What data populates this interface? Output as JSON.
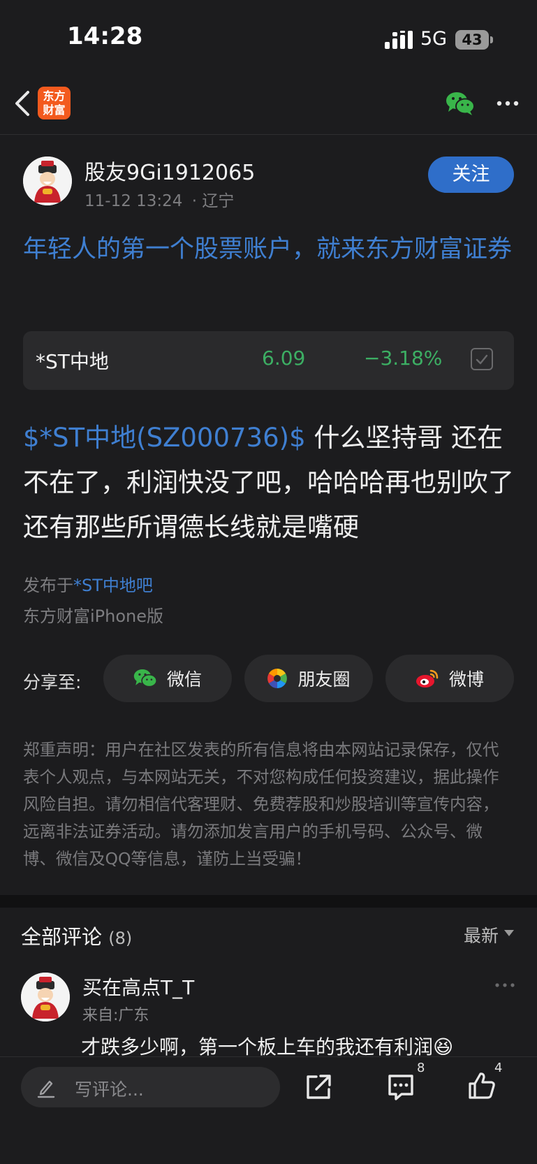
{
  "status_bar": {
    "time": "14:28",
    "network": "5G",
    "battery": "43"
  },
  "nav": {
    "logo_line1": "东方",
    "logo_line2": "财富"
  },
  "post": {
    "username": "股友9Gi1912065",
    "timestamp": "11-12 13:24",
    "location": "· 辽宁",
    "follow_label": "关注",
    "headline": "年轻人的第一个股票账户，就来东方财富证券",
    "stock": {
      "name": "*ST中地",
      "price": "6.09",
      "change": "−3.18%"
    },
    "body_tag": "$*ST中地(SZ000736)$",
    "body_text": " 什么坚持哥 还在不在了，利润快没了吧，哈哈哈再也别吹了 还有那些所谓德长线就是嘴硬",
    "posted_prefix": "发布于",
    "posted_bar": "*ST中地吧",
    "client": "东方财富iPhone版"
  },
  "share": {
    "label": "分享至:",
    "options": [
      {
        "label": "微信",
        "icon": "wechat-icon"
      },
      {
        "label": "朋友圈",
        "icon": "moments-icon"
      },
      {
        "label": "微博",
        "icon": "weibo-icon"
      }
    ]
  },
  "disclaimer": "郑重声明：用户在社区发表的所有信息将由本网站记录保存，仅代表个人观点，与本网站无关，不对您构成任何投资建议，据此操作风险自担。请勿相信代客理财、免费荐股和炒股培训等宣传内容，远离非法证券活动。请勿添加发言用户的手机号码、公众号、微博、微信及QQ等信息，谨防上当受骗！",
  "comments": {
    "title": "全部评论",
    "count": "(8)",
    "sort": "最新",
    "items": [
      {
        "username": "买在高点T_T",
        "from": "来自:广东",
        "text": "才跌多少啊，第一个板上车的我还有利润😆"
      }
    ]
  },
  "bottom_bar": {
    "placeholder": "写评论...",
    "comment_count": "8",
    "like_count": "4"
  },
  "colors": {
    "link_blue": "#3f7fd1",
    "down_green": "#3cae63",
    "follow_blue": "#2f6ec9",
    "brand_orange": "#f35a1e"
  }
}
